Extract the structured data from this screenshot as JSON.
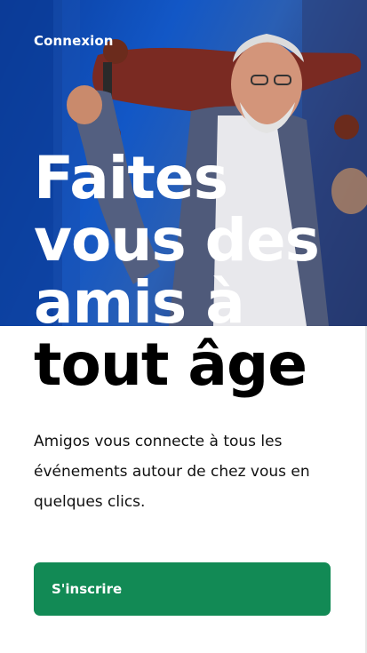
{
  "header": {
    "login_label": "Connexion"
  },
  "hero": {
    "headline_lines": [
      "Faites",
      "vous des",
      "amis à",
      "tout âge"
    ],
    "description": "Amigos vous connecte à tous les événements autour de chez vous en quelques clics.",
    "photo_subject": "smiling-senior-man-with-skateboard"
  },
  "actions": {
    "signup_label": "S'inscrire"
  },
  "colors": {
    "accent": "#128a55",
    "hero_blue": "#1257c6"
  }
}
